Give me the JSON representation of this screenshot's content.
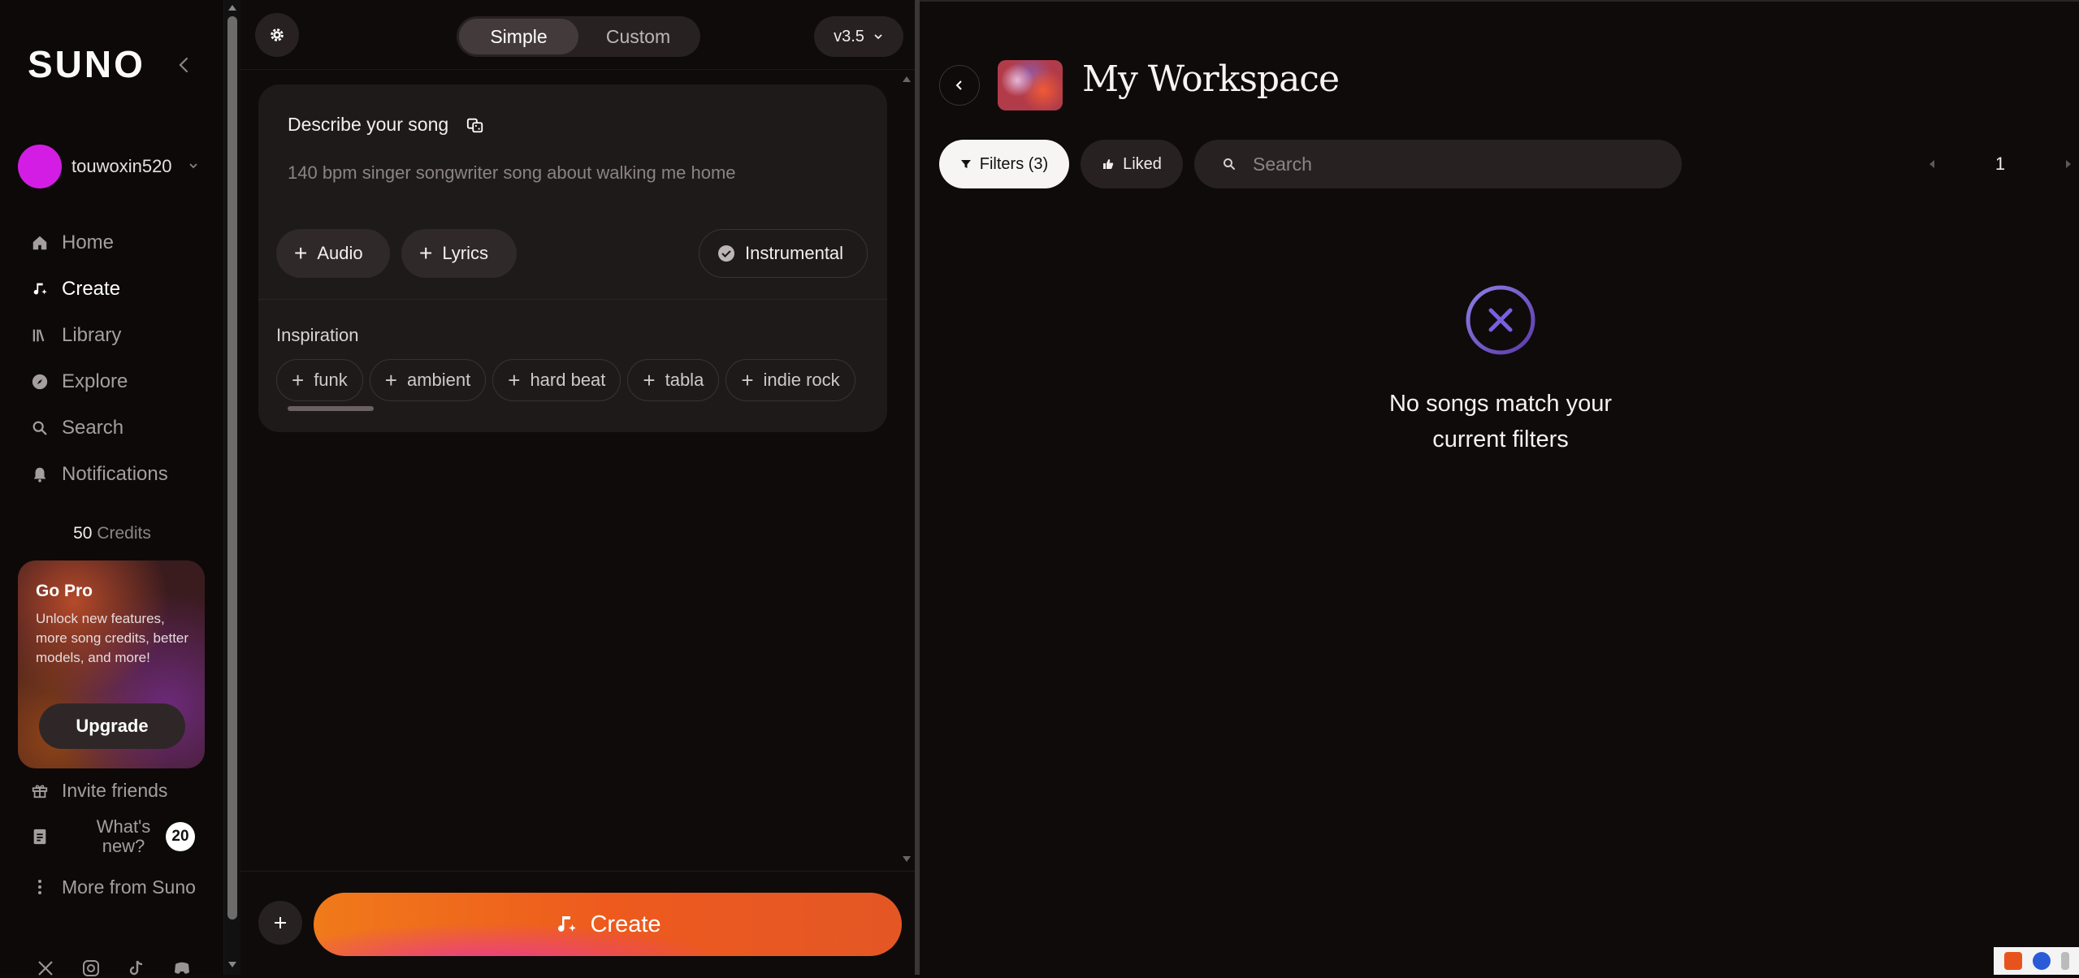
{
  "sidebar": {
    "logo": "SUNO",
    "username": "touwoxin520",
    "nav": [
      {
        "label": "Home",
        "icon": "home-icon"
      },
      {
        "label": "Create",
        "icon": "create-icon"
      },
      {
        "label": "Library",
        "icon": "library-icon"
      },
      {
        "label": "Explore",
        "icon": "explore-icon"
      },
      {
        "label": "Search",
        "icon": "search-icon"
      },
      {
        "label": "Notifications",
        "icon": "bell-icon"
      }
    ],
    "credits_value": "50",
    "credits_label": "Credits",
    "gopro": {
      "title": "Go Pro",
      "text": "Unlock new features, more song credits, better models, and more!",
      "button": "Upgrade"
    },
    "invite": "Invite friends",
    "whats_new": "What's new?",
    "whats_new_count": "20",
    "more": "More from Suno"
  },
  "create_panel": {
    "mode_tabs": [
      "Simple",
      "Custom"
    ],
    "active_mode": "Simple",
    "version": "v3.5",
    "card_title": "Describe your song",
    "description_placeholder": "140 bpm singer songwriter song about walking me home",
    "audio_label": "Audio",
    "lyrics_label": "Lyrics",
    "instrumental_label": "Instrumental",
    "inspiration_title": "Inspiration",
    "inspiration_tags": [
      "funk",
      "ambient",
      "hard beat",
      "tabla",
      "indie rock"
    ],
    "create_label": "Create"
  },
  "workspace": {
    "title": "My Workspace",
    "filters_label": "Filters (3)",
    "liked_label": "Liked",
    "search_placeholder": "Search",
    "page": "1",
    "empty_message": "No songs match your current filters"
  },
  "colors": {
    "background": "#0f0b0b",
    "accent_orange": "#f07a1a",
    "avatar": "#d41de4"
  }
}
